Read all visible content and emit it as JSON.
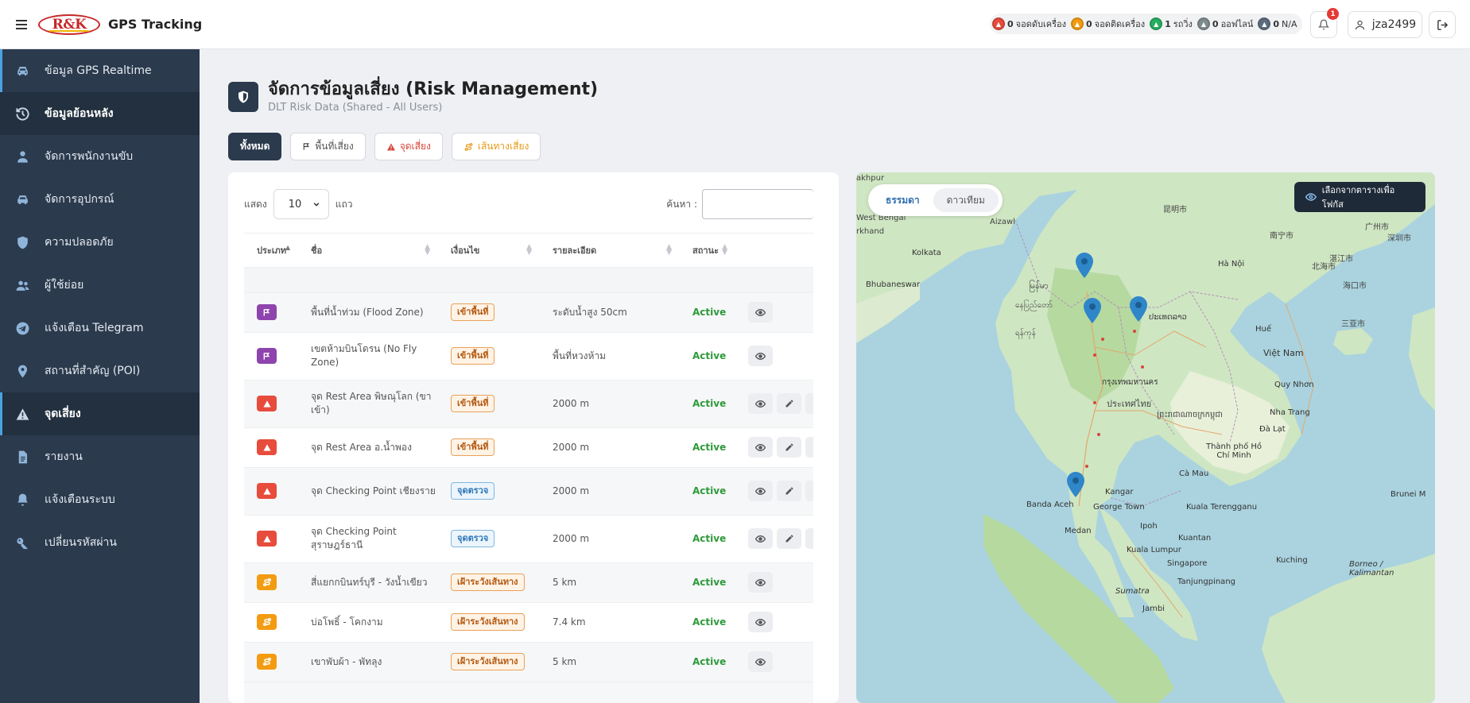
{
  "header": {
    "logo_text": "R&K",
    "app_title": "GPS Tracking",
    "status": [
      {
        "count": "0",
        "label": "จอดดับเครื่อง",
        "color": "#e74c3c"
      },
      {
        "count": "0",
        "label": "จอดติดเครื่อง",
        "color": "#f39c12"
      },
      {
        "count": "1",
        "label": "รถวิ่ง",
        "color": "#27ae60"
      },
      {
        "count": "0",
        "label": "ออฟไลน์",
        "color": "#7f8c8d"
      },
      {
        "count": "0",
        "label": "N/A",
        "color": "#5d6d7e"
      }
    ],
    "notification_count": "1",
    "username": "jza2499"
  },
  "sidebar": {
    "items": [
      {
        "label": "ข้อมูล GPS Realtime",
        "icon": "car-icon"
      },
      {
        "label": "ข้อมูลย้อนหลัง",
        "icon": "history-icon"
      },
      {
        "label": "จัดการพนักงานขับ",
        "icon": "driver-icon"
      },
      {
        "label": "จัดการอุปกรณ์",
        "icon": "device-icon"
      },
      {
        "label": "ความปลอดภัย",
        "icon": "shield-icon"
      },
      {
        "label": "ผู้ใช้ย่อย",
        "icon": "users-icon"
      },
      {
        "label": "แจ้งเตือน Telegram",
        "icon": "telegram-icon"
      },
      {
        "label": "สถานที่สำคัญ (POI)",
        "icon": "location-icon"
      },
      {
        "label": "จุดเสี่ยง",
        "icon": "warning-icon"
      },
      {
        "label": "รายงาน",
        "icon": "report-icon"
      },
      {
        "label": "แจ้งเตือนระบบ",
        "icon": "bell-icon"
      },
      {
        "label": "เปลี่ยนรหัสผ่าน",
        "icon": "key-icon"
      }
    ]
  },
  "page": {
    "title": "จัดการข้อมูลเสี่ยง (Risk Management)",
    "subtitle": "DLT Risk Data (Shared - All Users)"
  },
  "filters": {
    "all": "ทั้งหมด",
    "zone": "พื้นที่เสี่ยง",
    "point": "จุดเสี่ยง",
    "route": "เส้นทางเสี่ยง"
  },
  "table_controls": {
    "show_label": "แสดง",
    "page_length": "10",
    "rows_label": "แถว",
    "search_label": "ค้นหา :"
  },
  "table": {
    "columns": [
      "ประเภท",
      "ชื่อ",
      "เงื่อนไข",
      "รายละเอียด",
      "สถานะ"
    ],
    "rows": [
      {
        "type": "zone",
        "name": "พื้นที่น้ำท่วม (Flood Zone)",
        "condition": "เข้าพื้นที่",
        "condition_type": "zone",
        "detail": "ระดับน้ำสูง 50cm",
        "status": "Active",
        "editable": false
      },
      {
        "type": "zone",
        "name": "เขตห้ามบินโดรน (No Fly Zone)",
        "condition": "เข้าพื้นที่",
        "condition_type": "zone",
        "detail": "พื้นที่หวงห้าม",
        "status": "Active",
        "editable": false
      },
      {
        "type": "point",
        "name": "จุด Rest Area พิษณุโลก (ขาเข้า)",
        "condition": "เข้าพื้นที่",
        "condition_type": "zone",
        "detail": "2000 m",
        "status": "Active",
        "editable": true
      },
      {
        "type": "point",
        "name": "จุด Rest Area อ.น้ำพอง",
        "condition": "เข้าพื้นที่",
        "condition_type": "zone",
        "detail": "2000 m",
        "status": "Active",
        "editable": true
      },
      {
        "type": "point",
        "name": "จุด Checking Point เชียงราย",
        "condition": "จุดตรวจ",
        "condition_type": "check",
        "detail": "2000 m",
        "status": "Active",
        "editable": true
      },
      {
        "type": "point",
        "name": "จุด Checking Point สุราษฎร์ธานี",
        "condition": "จุดตรวจ",
        "condition_type": "check",
        "detail": "2000 m",
        "status": "Active",
        "editable": true
      },
      {
        "type": "route",
        "name": "สี่แยกกบินทร์บุรี - วังน้ำเขียว",
        "condition": "เฝ้าระวังเส้นทาง",
        "condition_type": "route",
        "detail": "5 km",
        "status": "Active",
        "editable": false
      },
      {
        "type": "route",
        "name": "บ่อโพธิ์ - โคกงาม",
        "condition": "เฝ้าระวังเส้นทาง",
        "condition_type": "route",
        "detail": "7.4 km",
        "status": "Active",
        "editable": false
      },
      {
        "type": "route",
        "name": "เขาพับผ้า - พัทลุง",
        "condition": "เฝ้าระวังเส้นทาง",
        "condition_type": "route",
        "detail": "5 km",
        "status": "Active",
        "editable": false
      }
    ]
  },
  "map": {
    "tab_standard": "ธรรมดา",
    "tab_satellite": "ดาวเทียม",
    "hint": "เลือกจากตารางเพื่อโฟกัส",
    "labels": {
      "khpur": "akhpur",
      "west_bengal": "West Bengal",
      "aizawl": "Aizawl",
      "khand": "rkhand",
      "kolkata": "Kolkata",
      "bhubaneswar": "Bhubaneswar",
      "myanmar": "မြန်မာ",
      "naypyitaw": "နေပြည်တော်",
      "yangon": "ရန်ကုန်",
      "hanoi": "Hà Nội",
      "laos": "ປະເທດລາວ",
      "bangkok": "กรุงเทพมหานคร",
      "thailand": "ประเทศไทย",
      "cambodia": "ព្រះរាជាណាចក្រកម្ពុជា",
      "vietnam": "Việt Nam",
      "hue": "Huế",
      "quy_nhon": "Quy Nhơn",
      "nha_trang": "Nha Trang",
      "da_lat": "Đà Lạt",
      "hcm": "Thành phố Hồ Chí Minh",
      "ca_mau": "Cà Mau",
      "banda_aceh": "Banda Aceh",
      "kangar": "Kangar",
      "george_town": "George Town",
      "kuala_terengganu": "Kuala Terengganu",
      "medan": "Medan",
      "ipoh": "Ipoh",
      "kuantan": "Kuantan",
      "kuala_lumpur": "Kuala Lumpur",
      "singapore": "Singapore",
      "tanjungpinang": "Tanjungpinang",
      "sumatra": "Sumatra",
      "jambi": "Jambi",
      "kuching": "Kuching",
      "borneo": "Borneo /\nKalimantan",
      "brunei": "Brunei M",
      "hainan": "海口市",
      "sanya": "三亚市",
      "nanning": "南宁市",
      "kunming": "昆明市",
      "zhanjiang": "湛江市",
      "beihai": "北海市",
      "guangzhou": "广州市",
      "shenzhen": "深圳市"
    }
  }
}
